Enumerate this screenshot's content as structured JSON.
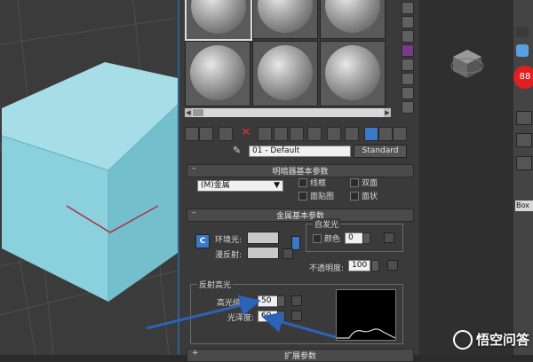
{
  "material_editor": {
    "material_name": "01 - Default",
    "material_type_button": "Standard",
    "shader_rollout": {
      "title": "明暗器基本参数",
      "shader_type": "(M)金属",
      "options": [
        "线框",
        "双面",
        "面贴图",
        "面状"
      ]
    },
    "metal_rollout": {
      "title": "金属基本参数",
      "ambient_label": "环境光:",
      "diffuse_label": "漫反射:",
      "lock_label": "C",
      "self_illum_label": "自发光",
      "color_label": "颜色",
      "color_value": "0",
      "opacity_label": "不透明度:",
      "opacity_value": "100",
      "spec_group_label": "反射高光",
      "spec_level_label": "高光级别:",
      "spec_level_value": "50",
      "glossiness_label": "光泽度:",
      "glossiness_value": "60"
    },
    "next_rollout_title": "扩展参数"
  },
  "right_panel": {
    "zoom_badge": "88",
    "field_text": "Box"
  },
  "watermark": {
    "text": "悟空问答"
  },
  "colors": {
    "cube_top": "#a6dde6",
    "cube_left": "#8ad0dd",
    "cube_right": "#74bfcd",
    "arrow": "#2c62b8",
    "window_border": "#2f5f8a",
    "badge_red": "#e02020"
  },
  "icons": [
    "eyedropper-icon",
    "close-icon",
    "lock-icon",
    "arrow-icon"
  ]
}
